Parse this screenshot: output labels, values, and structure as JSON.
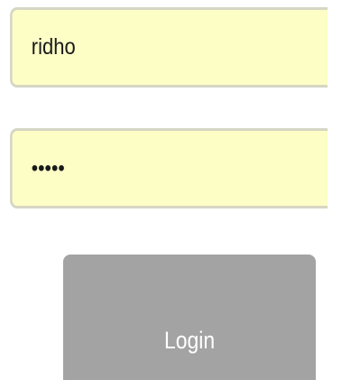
{
  "form": {
    "username_value": "ridho",
    "password_value": "*****",
    "login_label": "Login"
  },
  "colors": {
    "input_background": "#fdfdc6",
    "input_border": "#d6d6c4",
    "button_background": "#a3a3a3",
    "button_text": "#ffffff"
  }
}
